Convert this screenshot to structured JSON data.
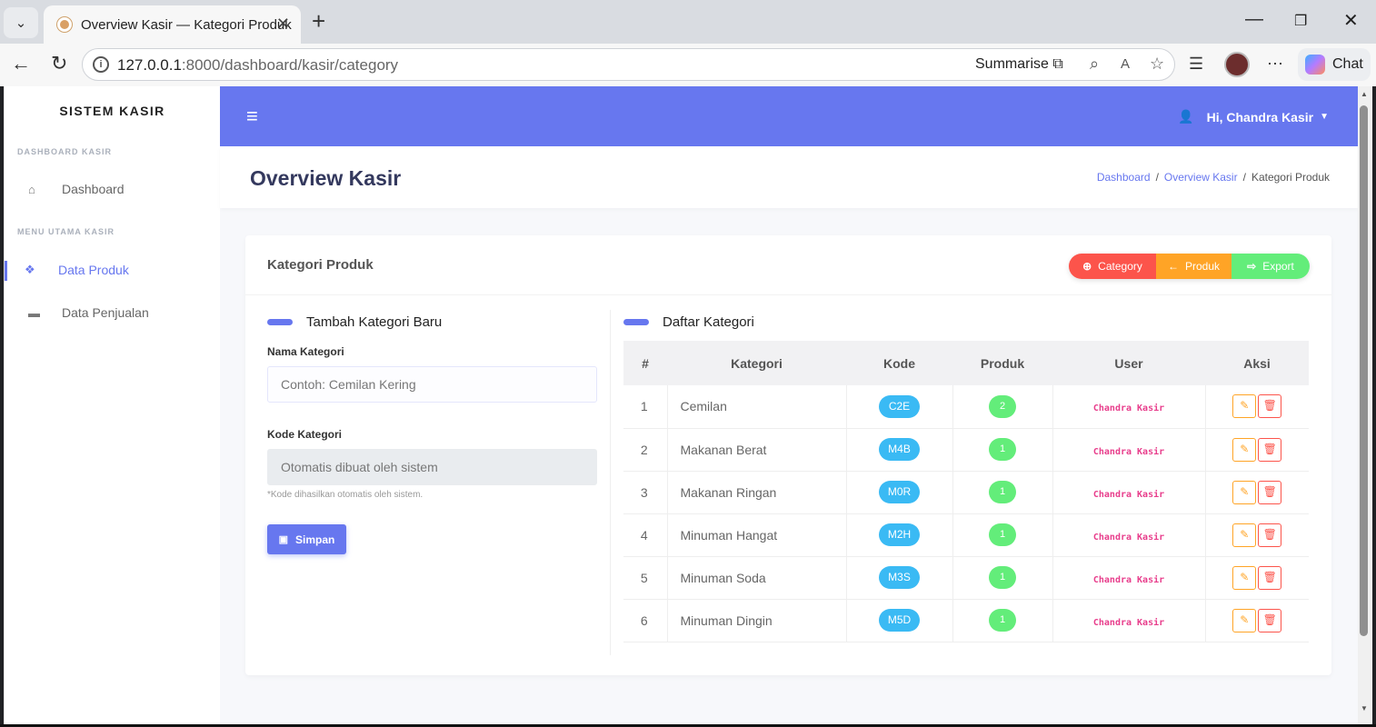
{
  "browser": {
    "tab_title": "Overview Kasir — Kategori Produk",
    "tab_close": "✕",
    "new_tab": "+",
    "url_host": "127.0.0.1",
    "url_path": ":8000/dashboard/kasir/category",
    "summarise_label": "Summarise",
    "chat_label": "Chat"
  },
  "sidebar": {
    "brand": "SISTEM KASIR",
    "section1": "DASHBOARD KASIR",
    "section2": "MENU UTAMA KASIR",
    "items": [
      {
        "label": "Dashboard",
        "icon": "home-icon"
      },
      {
        "label": "Data Produk",
        "icon": "cubes-icon",
        "active": true
      },
      {
        "label": "Data Penjualan",
        "icon": "money-icon"
      }
    ]
  },
  "topnav": {
    "user_greeting": "Hi, Chandra Kasir"
  },
  "header": {
    "title": "Overview Kasir",
    "breadcrumb": [
      "Dashboard",
      "Overview Kasir",
      "Kategori Produk"
    ]
  },
  "card": {
    "title": "Kategori Produk",
    "buttons": [
      "Category",
      "Produk",
      "Export"
    ]
  },
  "form": {
    "title": "Tambah Kategori Baru",
    "nama_label": "Nama Kategori",
    "nama_placeholder": "Contoh: Cemilan Kering",
    "kode_label": "Kode Kategori",
    "kode_placeholder": "Otomatis dibuat oleh sistem",
    "hint": "*Kode dihasilkan otomatis oleh sistem.",
    "save_label": "Simpan"
  },
  "table": {
    "title": "Daftar Kategori",
    "headers": [
      "#",
      "Kategori",
      "Kode",
      "Produk",
      "User",
      "Aksi"
    ],
    "rows": [
      {
        "no": "1",
        "kategori": "Cemilan",
        "kode": "C2E",
        "produk": "2",
        "user": "Chandra Kasir"
      },
      {
        "no": "2",
        "kategori": "Makanan Berat",
        "kode": "M4B",
        "produk": "1",
        "user": "Chandra Kasir"
      },
      {
        "no": "3",
        "kategori": "Makanan Ringan",
        "kode": "M0R",
        "produk": "1",
        "user": "Chandra Kasir"
      },
      {
        "no": "4",
        "kategori": "Minuman Hangat",
        "kode": "M2H",
        "produk": "1",
        "user": "Chandra Kasir"
      },
      {
        "no": "5",
        "kategori": "Minuman Soda",
        "kode": "M3S",
        "produk": "1",
        "user": "Chandra Kasir"
      },
      {
        "no": "6",
        "kategori": "Minuman Dingin",
        "kode": "M5D",
        "produk": "1",
        "user": "Chandra Kasir"
      }
    ]
  },
  "colors": {
    "primary": "#6777ef",
    "danger": "#fc544b",
    "warning": "#ffa426",
    "success": "#63ed7a",
    "info": "#3abaf4"
  }
}
